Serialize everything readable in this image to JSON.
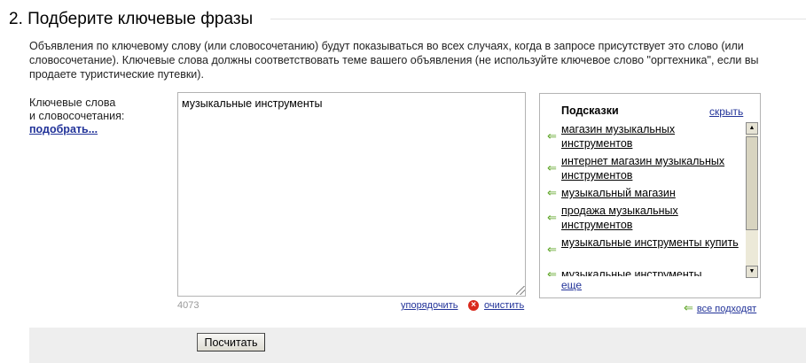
{
  "section": {
    "title": "2. Подберите ключевые фразы",
    "description": "Объявления по ключевому слову (или словосочетанию) будут показываться во всех случаях, когда в запросе присутствует это слово (или словосочетание). Ключевые слова должны соответствовать теме вашего объявления (не используйте ключевое слово \"оргтехника\", если вы продаете туристические путевки)."
  },
  "keywords": {
    "label_line1": "Ключевые слова",
    "label_line2": "и словосочетания:",
    "pick_link": "подобрать...",
    "value": "музыкальные инструменты",
    "counter": "4073",
    "sort_link": "упорядочить",
    "clear_link": "очистить"
  },
  "hints": {
    "title": "Подсказки",
    "hide_link": "скрыть",
    "items": [
      "магазин музыкальных инструментов",
      "интернет магазин музыкальных инструментов",
      "музыкальный магазин",
      "продажа музыкальных инструментов",
      "музыкальные инструменты купить",
      "музыкальные инструменты"
    ],
    "more_link": "еще",
    "all_fit_link": "все подходят"
  },
  "actions": {
    "calculate_button": "Посчитать"
  },
  "colors": {
    "link": "#223399",
    "hint_arrow": "#5aa321",
    "clear_icon": "#d9291c",
    "bottom_bar": "#eeeeee"
  }
}
